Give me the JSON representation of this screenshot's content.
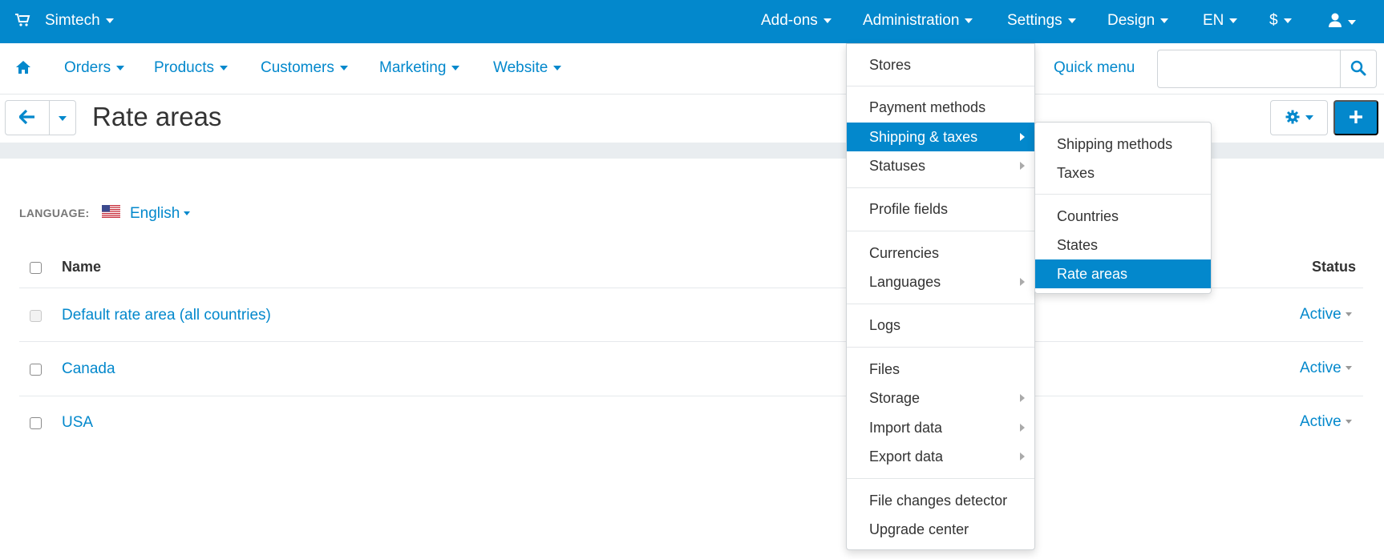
{
  "topbar": {
    "store_name": "Simtech",
    "nav": [
      "Add-ons",
      "Administration",
      "Settings",
      "Design",
      "EN",
      "$"
    ],
    "icons": {
      "cart": "cart-icon",
      "user": "user-icon"
    }
  },
  "subnav": {
    "items": [
      "Orders",
      "Products",
      "Customers",
      "Marketing",
      "Website"
    ],
    "quick_menu": "Quick menu",
    "search_placeholder": ""
  },
  "page": {
    "title": "Rate areas"
  },
  "language": {
    "label": "LANGUAGE:",
    "value": "English"
  },
  "table": {
    "headers": {
      "name": "Name",
      "status": "Status"
    },
    "rows": [
      {
        "name": "Default rate area (all countries)",
        "status": "Active",
        "checkbox_disabled": true
      },
      {
        "name": "Canada",
        "status": "Active",
        "checkbox_disabled": false
      },
      {
        "name": "USA",
        "status": "Active",
        "checkbox_disabled": false
      }
    ]
  },
  "admin_menu": {
    "items": [
      "Stores",
      "Payment methods",
      "Shipping & taxes",
      "Statuses",
      "Profile fields",
      "Currencies",
      "Languages",
      "Logs",
      "Files",
      "Storage",
      "Import data",
      "Export data",
      "File changes detector",
      "Upgrade center"
    ],
    "active": "Shipping & taxes"
  },
  "shipping_menu": {
    "items": [
      "Shipping methods",
      "Taxes",
      "Countries",
      "States",
      "Rate areas"
    ],
    "active": "Rate areas"
  },
  "colors": {
    "brand": "#0388cc",
    "text": "#333333",
    "muted": "#777777"
  }
}
